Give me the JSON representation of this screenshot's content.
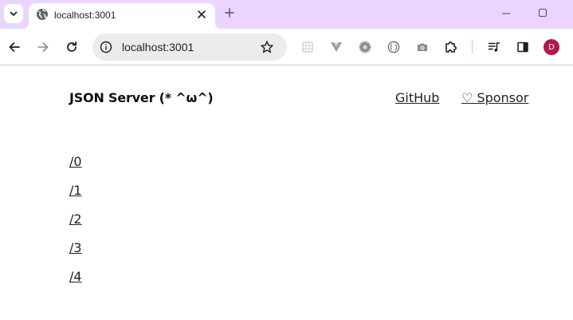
{
  "browser": {
    "tab": {
      "title": "localhost:3001",
      "favicon": "globe-icon"
    },
    "omnibox": {
      "url": "localhost:3001"
    },
    "profile": {
      "initial": "D",
      "color": "#b3184d"
    },
    "accent": "#e9d5ff"
  },
  "page": {
    "brand": "JSON Server (* ^ω^)",
    "nav": {
      "github": "GitHub",
      "sponsor": "♡ Sponsor"
    },
    "routes": [
      "/0",
      "/1",
      "/2",
      "/3",
      "/4"
    ]
  }
}
